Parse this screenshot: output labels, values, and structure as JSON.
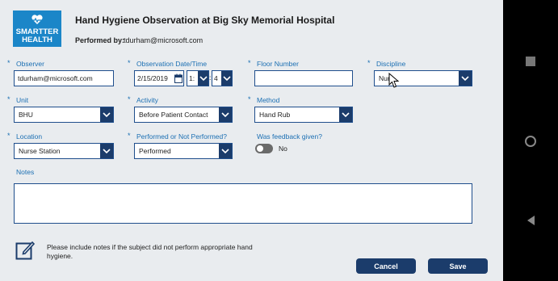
{
  "header": {
    "logo_line1": "SMARTTER",
    "logo_line2": "HEALTH",
    "title": "Hand Hygiene Observation at Big Sky Memorial Hospital",
    "performed_by_label": "Performed by:",
    "performed_by_value": "tdurham@microsoft.com"
  },
  "fields": {
    "observer": {
      "label": "Observer",
      "value": "tdurham@microsoft.com"
    },
    "observation_date": {
      "label": "Observation Date/Time",
      "date": "2/15/2019",
      "hour": "1:",
      "minute": "4"
    },
    "floor_number": {
      "label": "Floor Number",
      "value": ""
    },
    "discipline": {
      "label": "Discipline",
      "value": "Nur"
    },
    "unit": {
      "label": "Unit",
      "value": "BHU"
    },
    "activity": {
      "label": "Activity",
      "value": "Before Patient Contact"
    },
    "method": {
      "label": "Method",
      "value": "Hand Rub"
    },
    "location": {
      "label": "Location",
      "value": "Nurse Station"
    },
    "performed": {
      "label": "Performed or Not Performed?",
      "value": "Performed"
    },
    "feedback": {
      "label": "Was feedback given?",
      "value": "No"
    },
    "notes": {
      "label": "Notes",
      "value": ""
    }
  },
  "required_marker": "*",
  "time_separator": ":",
  "info_text": "Please include notes if the subject did not perform appropriate hand hygiene.",
  "buttons": {
    "cancel": "Cancel",
    "save": "Save"
  },
  "colors": {
    "accent": "#1b3c6b",
    "label": "#1b6fb3",
    "logo": "#1b86c8",
    "background": "#e9ecef"
  },
  "icons": {
    "logo": "heart-pulse-icon",
    "calendar": "calendar-icon",
    "chevron": "chevron-down-icon",
    "info": "edit-note-icon",
    "cursor": "mouse-pointer-icon",
    "nav_recent": "square-icon",
    "nav_home": "circle-icon",
    "nav_back": "triangle-back-icon"
  }
}
